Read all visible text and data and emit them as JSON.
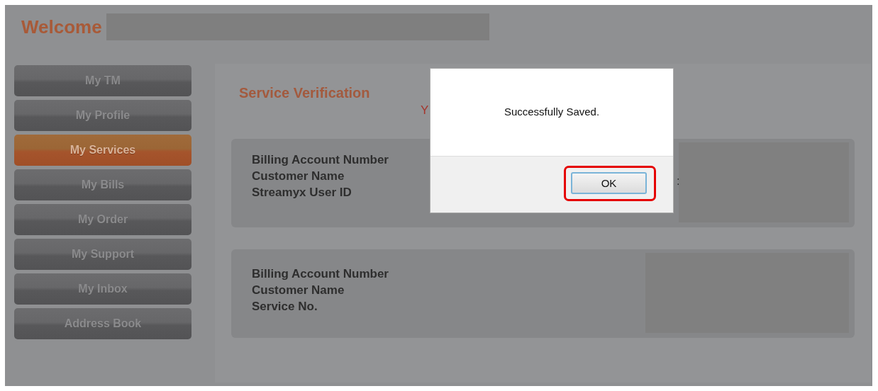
{
  "header": {
    "title": "Welcome"
  },
  "sidebar": {
    "items": [
      {
        "label": "My TM",
        "selected": false
      },
      {
        "label": "My Profile",
        "selected": false
      },
      {
        "label": "My Services",
        "selected": true
      },
      {
        "label": "My Bills",
        "selected": false
      },
      {
        "label": "My Order",
        "selected": false
      },
      {
        "label": "My Support",
        "selected": false
      },
      {
        "label": "My Inbox",
        "selected": false
      },
      {
        "label": "Address Book",
        "selected": false
      }
    ]
  },
  "content": {
    "title": "Service Verification",
    "notice": "Y",
    "cards": [
      {
        "labels": [
          "Billing Account Number",
          "Customer Name",
          "Streamyx User ID"
        ],
        "separator": ":"
      },
      {
        "labels": [
          "Billing Account Number",
          "Customer Name",
          "Service No."
        ]
      }
    ]
  },
  "dialog": {
    "message": "Successfully Saved.",
    "button": {
      "label": "OK",
      "highlighted": true
    }
  }
}
